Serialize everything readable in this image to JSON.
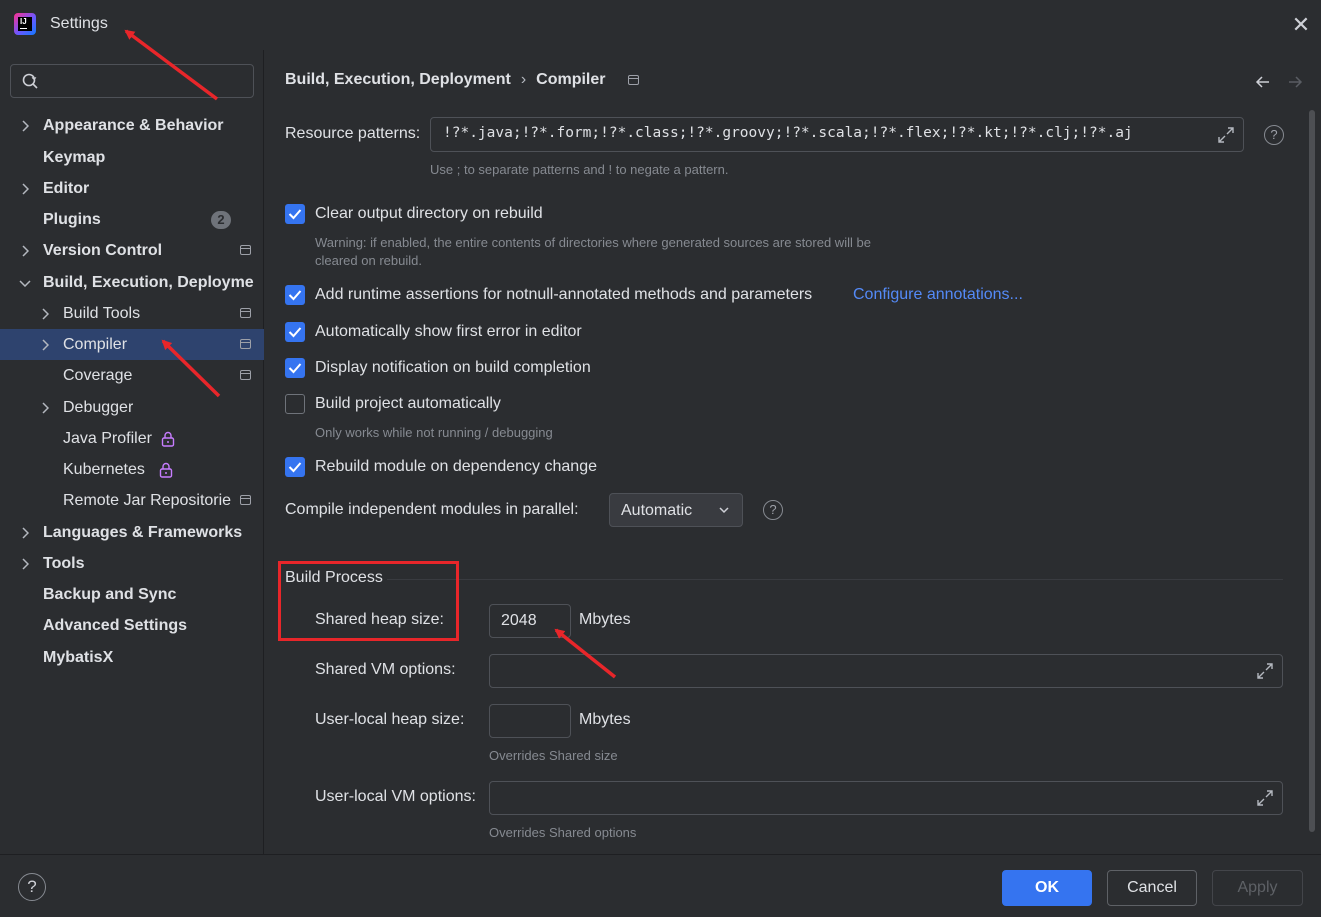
{
  "window": {
    "title": "Settings"
  },
  "search": {
    "placeholder": ""
  },
  "sidebar": {
    "items": [
      {
        "label": "Appearance & Behavior",
        "bold": true
      },
      {
        "label": "Keymap",
        "bold": true
      },
      {
        "label": "Editor",
        "bold": true
      },
      {
        "label": "Plugins",
        "bold": true,
        "badge": "2"
      },
      {
        "label": "Version Control",
        "bold": true
      },
      {
        "label": "Build, Execution, Deployme",
        "bold": true
      },
      {
        "label": "Build Tools"
      },
      {
        "label": "Compiler"
      },
      {
        "label": "Coverage"
      },
      {
        "label": "Debugger"
      },
      {
        "label": "Java Profiler"
      },
      {
        "label": "Kubernetes"
      },
      {
        "label": "Remote Jar Repositorie"
      },
      {
        "label": "Languages & Frameworks",
        "bold": true
      },
      {
        "label": "Tools",
        "bold": true
      },
      {
        "label": "Backup and Sync",
        "bold": true
      },
      {
        "label": "Advanced Settings",
        "bold": true
      },
      {
        "label": "MybatisX",
        "bold": true
      }
    ]
  },
  "breadcrumb": {
    "parent": "Build, Execution, Deployment",
    "separator": "›",
    "current": "Compiler"
  },
  "compiler": {
    "resource_patterns_label": "Resource patterns:",
    "resource_patterns_value": "!?*.java;!?*.form;!?*.class;!?*.groovy;!?*.scala;!?*.flex;!?*.kt;!?*.clj;!?*.aj",
    "resource_patterns_hint": "Use ; to separate patterns and ! to negate a pattern.",
    "clear_output_label": "Clear output directory on rebuild",
    "clear_output_checked": true,
    "clear_output_warning_1": "Warning: if enabled, the entire contents of directories where generated sources are stored will be",
    "clear_output_warning_2": "cleared on rebuild.",
    "runtime_assertions_label": "Add runtime assertions for notnull-annotated methods and parameters",
    "runtime_assertions_checked": true,
    "configure_annotations_link": "Configure annotations...",
    "show_first_error_label": "Automatically show first error in editor",
    "show_first_error_checked": true,
    "display_notification_label": "Display notification on build completion",
    "display_notification_checked": true,
    "build_automatically_label": "Build project automatically",
    "build_automatically_checked": false,
    "build_automatically_hint": "Only works while not running / debugging",
    "rebuild_module_label": "Rebuild module on dependency change",
    "rebuild_module_checked": true,
    "parallel_label": "Compile independent modules in parallel:",
    "parallel_value": "Automatic"
  },
  "build_process": {
    "title": "Build Process",
    "shared_heap_label": "Shared heap size:",
    "shared_heap_value": "2048",
    "shared_heap_unit": "Mbytes",
    "shared_vm_label": "Shared VM options:",
    "shared_vm_value": "",
    "user_heap_label": "User-local heap size:",
    "user_heap_value": "",
    "user_heap_unit": "Mbytes",
    "user_heap_hint": "Overrides Shared size",
    "user_vm_label": "User-local VM options:",
    "user_vm_value": "",
    "user_vm_hint": "Overrides Shared options"
  },
  "footer": {
    "help": "?",
    "ok": "OK",
    "cancel": "Cancel",
    "apply": "Apply"
  },
  "colors": {
    "accent": "#3574f0",
    "selection": "#2e436e",
    "link": "#548af7",
    "annotation": "#e8262a",
    "background": "#2b2d30"
  }
}
